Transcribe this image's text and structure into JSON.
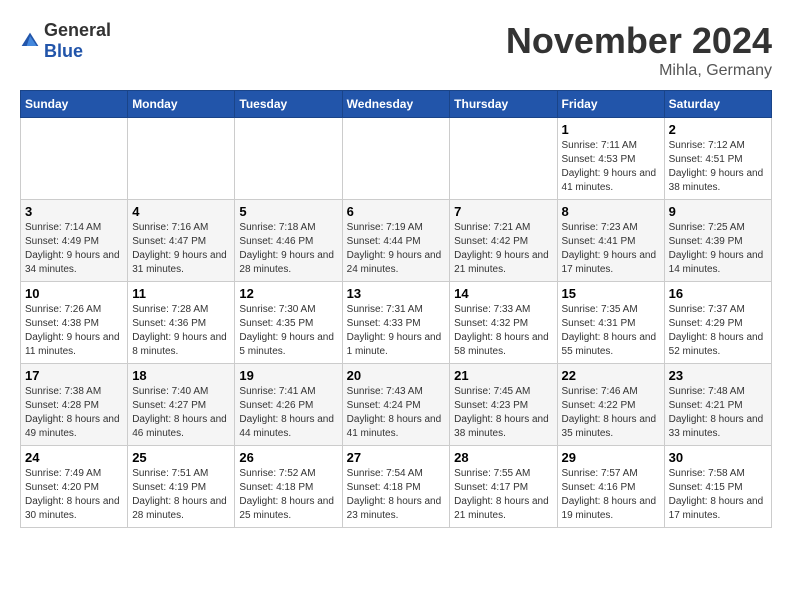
{
  "header": {
    "logo_general": "General",
    "logo_blue": "Blue",
    "month": "November 2024",
    "location": "Mihla, Germany"
  },
  "weekdays": [
    "Sunday",
    "Monday",
    "Tuesday",
    "Wednesday",
    "Thursday",
    "Friday",
    "Saturday"
  ],
  "weeks": [
    [
      {
        "day": "",
        "info": ""
      },
      {
        "day": "",
        "info": ""
      },
      {
        "day": "",
        "info": ""
      },
      {
        "day": "",
        "info": ""
      },
      {
        "day": "",
        "info": ""
      },
      {
        "day": "1",
        "info": "Sunrise: 7:11 AM\nSunset: 4:53 PM\nDaylight: 9 hours\nand 41 minutes."
      },
      {
        "day": "2",
        "info": "Sunrise: 7:12 AM\nSunset: 4:51 PM\nDaylight: 9 hours\nand 38 minutes."
      }
    ],
    [
      {
        "day": "3",
        "info": "Sunrise: 7:14 AM\nSunset: 4:49 PM\nDaylight: 9 hours\nand 34 minutes."
      },
      {
        "day": "4",
        "info": "Sunrise: 7:16 AM\nSunset: 4:47 PM\nDaylight: 9 hours\nand 31 minutes."
      },
      {
        "day": "5",
        "info": "Sunrise: 7:18 AM\nSunset: 4:46 PM\nDaylight: 9 hours\nand 28 minutes."
      },
      {
        "day": "6",
        "info": "Sunrise: 7:19 AM\nSunset: 4:44 PM\nDaylight: 9 hours\nand 24 minutes."
      },
      {
        "day": "7",
        "info": "Sunrise: 7:21 AM\nSunset: 4:42 PM\nDaylight: 9 hours\nand 21 minutes."
      },
      {
        "day": "8",
        "info": "Sunrise: 7:23 AM\nSunset: 4:41 PM\nDaylight: 9 hours\nand 17 minutes."
      },
      {
        "day": "9",
        "info": "Sunrise: 7:25 AM\nSunset: 4:39 PM\nDaylight: 9 hours\nand 14 minutes."
      }
    ],
    [
      {
        "day": "10",
        "info": "Sunrise: 7:26 AM\nSunset: 4:38 PM\nDaylight: 9 hours\nand 11 minutes."
      },
      {
        "day": "11",
        "info": "Sunrise: 7:28 AM\nSunset: 4:36 PM\nDaylight: 9 hours\nand 8 minutes."
      },
      {
        "day": "12",
        "info": "Sunrise: 7:30 AM\nSunset: 4:35 PM\nDaylight: 9 hours\nand 5 minutes."
      },
      {
        "day": "13",
        "info": "Sunrise: 7:31 AM\nSunset: 4:33 PM\nDaylight: 9 hours\nand 1 minute."
      },
      {
        "day": "14",
        "info": "Sunrise: 7:33 AM\nSunset: 4:32 PM\nDaylight: 8 hours\nand 58 minutes."
      },
      {
        "day": "15",
        "info": "Sunrise: 7:35 AM\nSunset: 4:31 PM\nDaylight: 8 hours\nand 55 minutes."
      },
      {
        "day": "16",
        "info": "Sunrise: 7:37 AM\nSunset: 4:29 PM\nDaylight: 8 hours\nand 52 minutes."
      }
    ],
    [
      {
        "day": "17",
        "info": "Sunrise: 7:38 AM\nSunset: 4:28 PM\nDaylight: 8 hours\nand 49 minutes."
      },
      {
        "day": "18",
        "info": "Sunrise: 7:40 AM\nSunset: 4:27 PM\nDaylight: 8 hours\nand 46 minutes."
      },
      {
        "day": "19",
        "info": "Sunrise: 7:41 AM\nSunset: 4:26 PM\nDaylight: 8 hours\nand 44 minutes."
      },
      {
        "day": "20",
        "info": "Sunrise: 7:43 AM\nSunset: 4:24 PM\nDaylight: 8 hours\nand 41 minutes."
      },
      {
        "day": "21",
        "info": "Sunrise: 7:45 AM\nSunset: 4:23 PM\nDaylight: 8 hours\nand 38 minutes."
      },
      {
        "day": "22",
        "info": "Sunrise: 7:46 AM\nSunset: 4:22 PM\nDaylight: 8 hours\nand 35 minutes."
      },
      {
        "day": "23",
        "info": "Sunrise: 7:48 AM\nSunset: 4:21 PM\nDaylight: 8 hours\nand 33 minutes."
      }
    ],
    [
      {
        "day": "24",
        "info": "Sunrise: 7:49 AM\nSunset: 4:20 PM\nDaylight: 8 hours\nand 30 minutes."
      },
      {
        "day": "25",
        "info": "Sunrise: 7:51 AM\nSunset: 4:19 PM\nDaylight: 8 hours\nand 28 minutes."
      },
      {
        "day": "26",
        "info": "Sunrise: 7:52 AM\nSunset: 4:18 PM\nDaylight: 8 hours\nand 25 minutes."
      },
      {
        "day": "27",
        "info": "Sunrise: 7:54 AM\nSunset: 4:18 PM\nDaylight: 8 hours\nand 23 minutes."
      },
      {
        "day": "28",
        "info": "Sunrise: 7:55 AM\nSunset: 4:17 PM\nDaylight: 8 hours\nand 21 minutes."
      },
      {
        "day": "29",
        "info": "Sunrise: 7:57 AM\nSunset: 4:16 PM\nDaylight: 8 hours\nand 19 minutes."
      },
      {
        "day": "30",
        "info": "Sunrise: 7:58 AM\nSunset: 4:15 PM\nDaylight: 8 hours\nand 17 minutes."
      }
    ]
  ]
}
